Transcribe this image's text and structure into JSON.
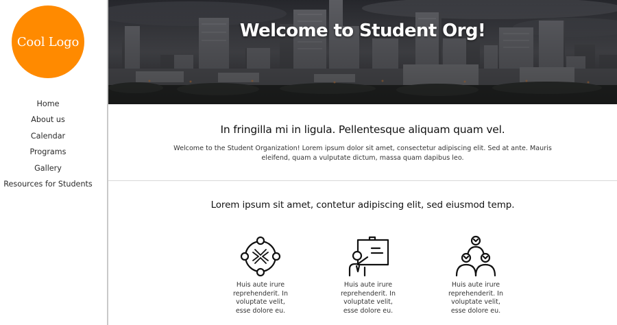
{
  "sidebar": {
    "logo_text": "Cool Logo",
    "logo_color": "#ff8a00",
    "nav": [
      {
        "label": "Home"
      },
      {
        "label": "About us"
      },
      {
        "label": "Calendar"
      },
      {
        "label": "Programs"
      },
      {
        "label": "Gallery"
      },
      {
        "label": "Resources for Students"
      }
    ]
  },
  "hero": {
    "title": "Welcome to Student Org!",
    "background": "city-skyline-image"
  },
  "intro": {
    "heading": "In fringilla mi in ligula. Pellentesque aliquam quam vel.",
    "body": "Welcome to the Student Organization! Lorem ipsum dolor sit amet, consectetur adipiscing elit. Sed at ante. Mauris eleifend, quam a vulputate dictum, massa quam dapibus leo."
  },
  "features": {
    "heading": "Lorem ipsum sit amet, contetur adipiscing elit, sed eiusmod temp.",
    "items": [
      {
        "icon": "team-circle-icon",
        "text": "Huis aute irure reprehenderit. In voluptate velit, esse dolore eu."
      },
      {
        "icon": "presentation-icon",
        "text": "Huis aute irure reprehenderit. In voluptate velit, esse dolore eu."
      },
      {
        "icon": "team-hierarchy-icon",
        "text": "Huis aute irure reprehenderit. In voluptate velit, esse dolore eu."
      }
    ]
  }
}
